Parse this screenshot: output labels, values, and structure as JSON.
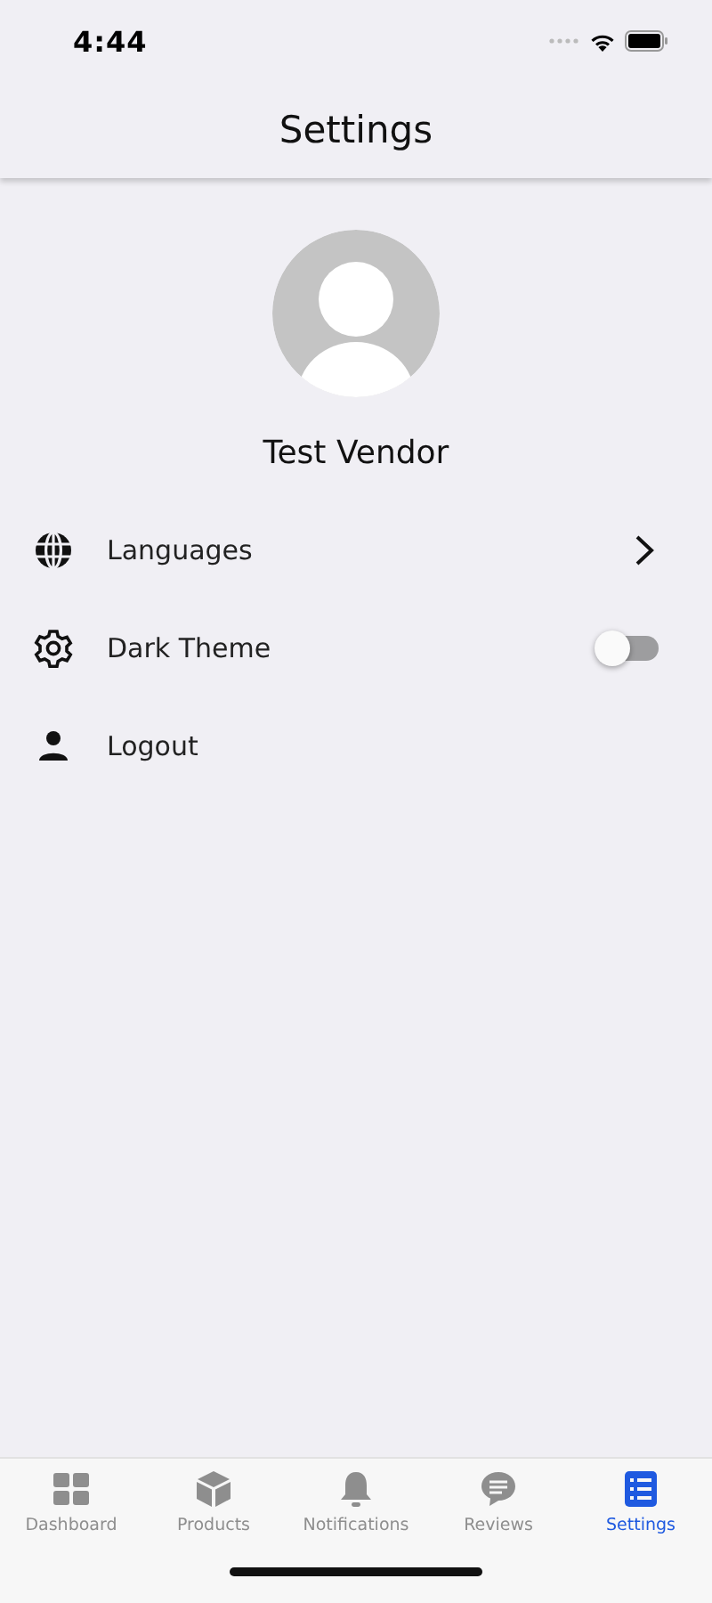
{
  "status_bar": {
    "time": "4:44"
  },
  "header": {
    "title": "Settings"
  },
  "profile": {
    "name": "Test Vendor"
  },
  "menu": [
    {
      "label": "Languages",
      "kind": "link"
    },
    {
      "label": "Dark Theme",
      "kind": "toggle",
      "on": false
    },
    {
      "label": "Logout",
      "kind": "plain"
    }
  ],
  "tabs": [
    {
      "label": "Dashboard",
      "selected": false
    },
    {
      "label": "Products",
      "selected": false
    },
    {
      "label": "Notifications",
      "selected": false
    },
    {
      "label": "Reviews",
      "selected": false
    },
    {
      "label": "Settings",
      "selected": true
    }
  ]
}
